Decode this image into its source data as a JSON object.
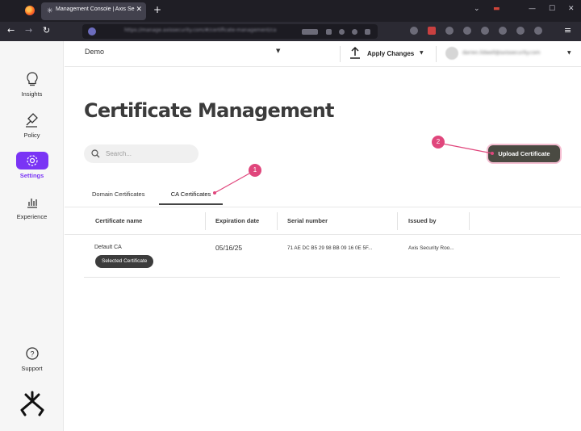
{
  "browser": {
    "tab_title": "Management Console | Axis Se",
    "tab_close": "✕",
    "new_tab": "+",
    "url": "https://manage.axissecurity.com/#/certificate-management/ca",
    "win_min": "—",
    "win_max": "☐",
    "win_close": "✕"
  },
  "sidebar": {
    "items": [
      {
        "label": "Insights",
        "icon": "lightbulb-icon"
      },
      {
        "label": "Policy",
        "icon": "gavel-icon"
      },
      {
        "label": "Settings",
        "icon": "gear-icon"
      },
      {
        "label": "Experience",
        "icon": "bar-chart-icon"
      }
    ],
    "support_label": "Support",
    "active_color": "#7a34f5"
  },
  "header": {
    "tenant": "Demo",
    "apply_changes": "Apply Changes",
    "user_email": "darren.lidwell@axissecurity.com"
  },
  "main": {
    "title": "Certificate Management",
    "search_placeholder": "Search...",
    "upload_button": "Upload Certificate",
    "tabs": [
      "Domain Certificates",
      "CA Certificates"
    ],
    "active_tab": "CA Certificates",
    "table": {
      "columns": [
        "Certificate name",
        "Expiration date",
        "Serial number",
        "Issued by"
      ],
      "rows": [
        {
          "name": "Default CA",
          "badge": "Selected Certificate",
          "expiration": "05/16/25",
          "serial": "71 AE DC B5 29 98 BB 09 16 0E 5F...",
          "issuer": "Axis Security Roo..."
        }
      ]
    }
  },
  "annotations": {
    "marker_1": "1",
    "marker_2": "2",
    "color": "#e0467c"
  }
}
